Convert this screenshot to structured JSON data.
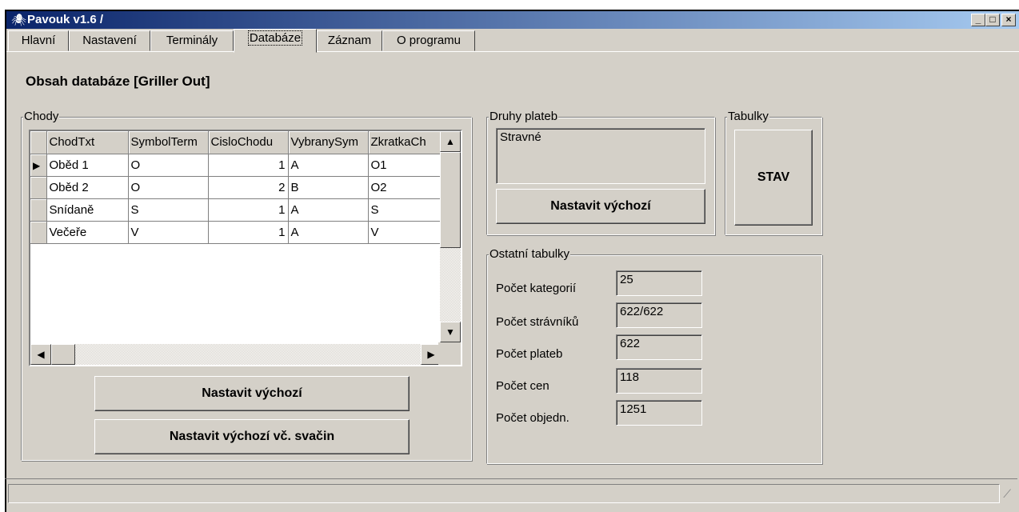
{
  "window": {
    "title": "Pavouk v1.6 /",
    "icon": "spider-icon",
    "min_label": "_",
    "max_label": "□",
    "close_label": "×",
    "title_bar_color": "#0a246a"
  },
  "tabs": [
    {
      "label": "Hlavní",
      "active": false
    },
    {
      "label": "Nastavení",
      "active": false
    },
    {
      "label": "Terminály",
      "active": false
    },
    {
      "label": "Databáze",
      "active": true
    },
    {
      "label": "Záznam",
      "active": false
    },
    {
      "label": "O programu",
      "active": false
    }
  ],
  "page": {
    "heading": "Obsah databáze [Griller Out]"
  },
  "chody": {
    "group_title": "Chody",
    "columns": [
      "ChodTxt",
      "SymbolTerm",
      "CisloChodu",
      "VybranySym",
      "ZkratkaCh"
    ],
    "rows": [
      [
        "Oběd 1",
        "O",
        "1",
        "A",
        "O1"
      ],
      [
        "Oběd 2",
        "O",
        "2",
        "B",
        "O2"
      ],
      [
        "Snídaně",
        "S",
        "1",
        "A",
        "S"
      ],
      [
        "Večeře",
        "V",
        "1",
        "A",
        "V"
      ]
    ],
    "current_row_marker": "▶",
    "btn_default": "Nastavit výchozí",
    "btn_default_snacks": "Nastavit výchozí vč. svačin"
  },
  "druhy_plateb": {
    "group_title": "Druhy plateb",
    "items": [
      "Stravné"
    ],
    "btn_default": "Nastavit výchozí"
  },
  "tabulky": {
    "group_title": "Tabulky",
    "btn_stav": "STAV"
  },
  "ostatni": {
    "group_title": "Ostatní tabulky",
    "rows": [
      {
        "label": "Počet kategorií",
        "value": "25"
      },
      {
        "label": "Počet strávníků",
        "value": "622/622"
      },
      {
        "label": "Počet plateb",
        "value": "622"
      },
      {
        "label": "Počet cen",
        "value": "118"
      },
      {
        "label": "Počet objedn.",
        "value": "1251"
      }
    ]
  }
}
